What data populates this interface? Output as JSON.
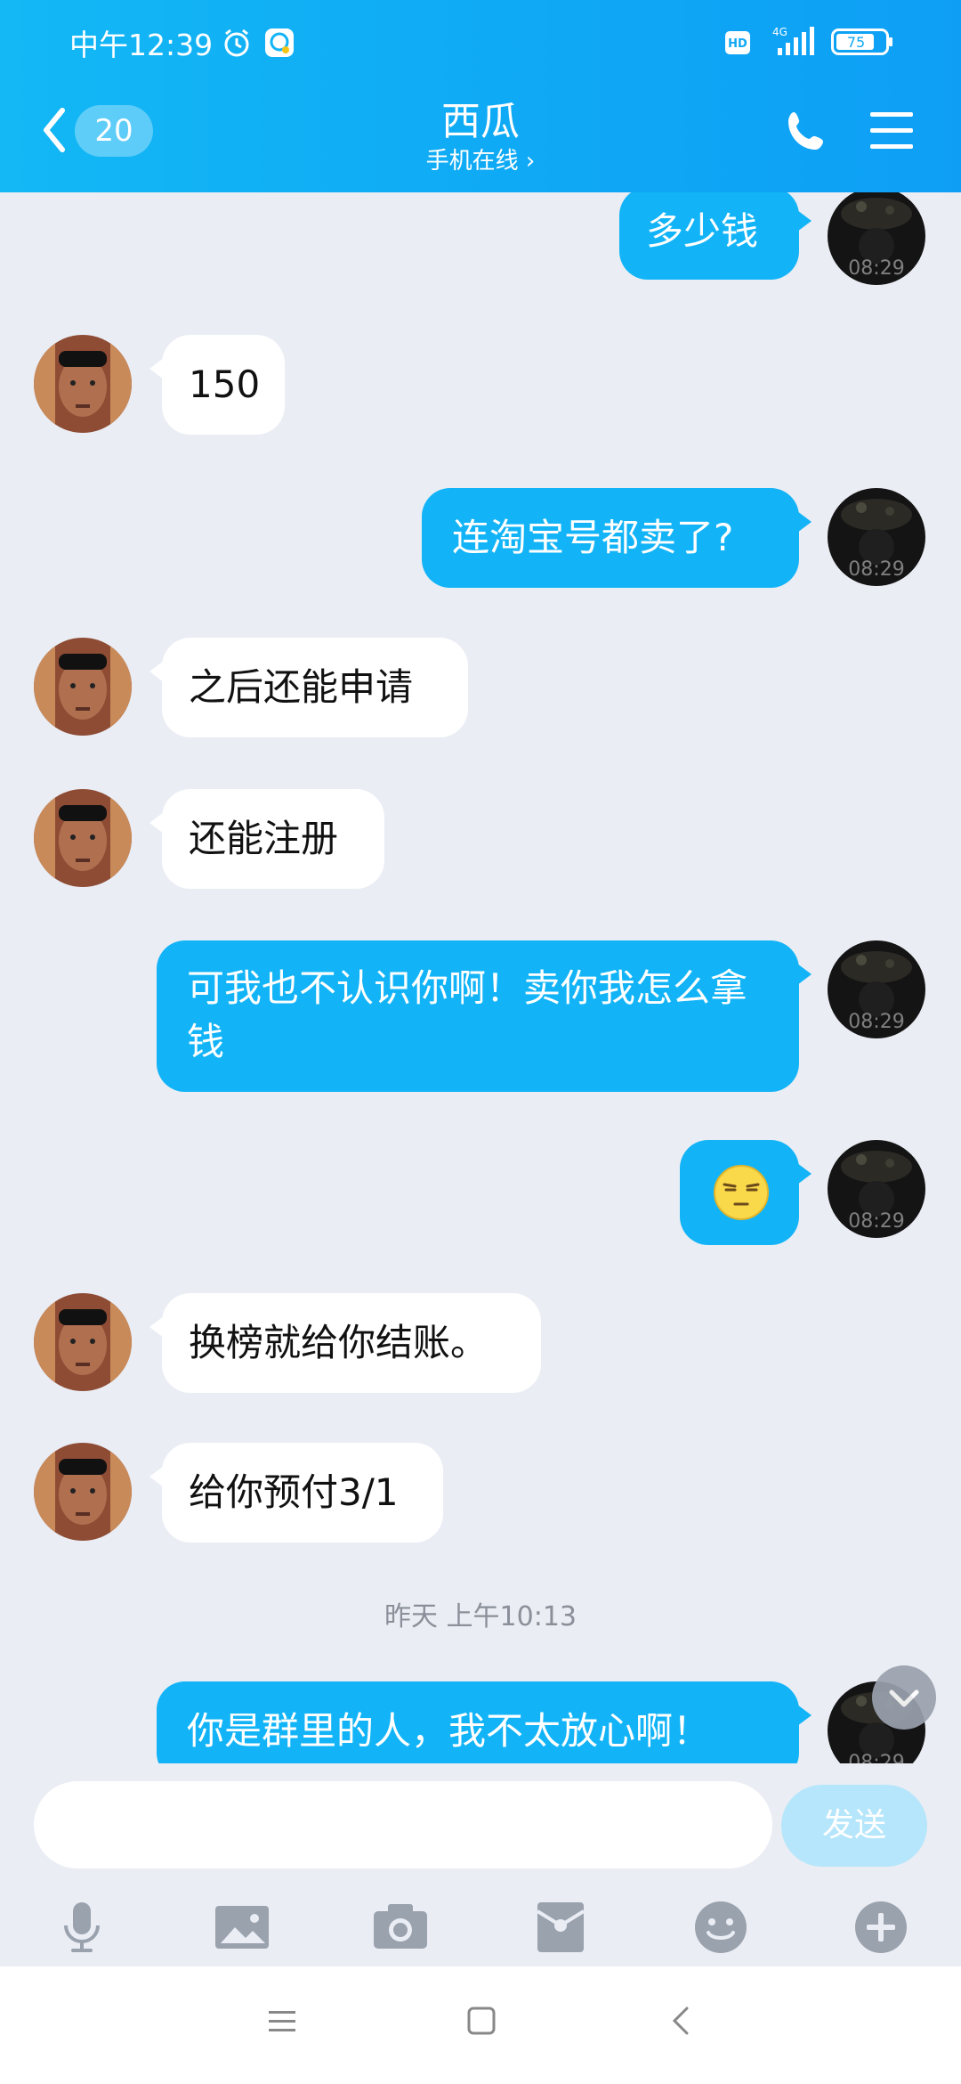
{
  "status_bar": {
    "time": "中午12:39",
    "battery": "75",
    "network": "4G",
    "hd": "HD"
  },
  "header": {
    "unread_count": "20",
    "title": "西瓜",
    "subtitle": "手机在线 ›"
  },
  "messages": [
    {
      "side": "out",
      "type": "text",
      "text": "多少钱"
    },
    {
      "side": "in",
      "type": "text",
      "text": "150"
    },
    {
      "side": "out",
      "type": "text",
      "text": "连淘宝号都卖了?"
    },
    {
      "side": "in",
      "type": "text",
      "text": "之后还能申请"
    },
    {
      "side": "in",
      "type": "text",
      "text": "还能注册"
    },
    {
      "side": "out",
      "type": "text",
      "text": "可我也不认识你啊！卖你我怎么拿钱"
    },
    {
      "side": "out",
      "type": "emoji",
      "text": "",
      "emoji": "smirk-emoji"
    },
    {
      "side": "in",
      "type": "text",
      "text": "换榜就给你结账。"
    },
    {
      "side": "in",
      "type": "text",
      "text": "给你预付3/1"
    },
    {
      "side": "out",
      "type": "text",
      "text": "你是群里的人，我不太放心啊！"
    }
  ],
  "avatar_overlay_text": "08:29",
  "timestamp_divider": "昨天 上午10:13",
  "composer": {
    "placeholder": "",
    "send_label": "发送"
  },
  "toolbar_icons": [
    "microphone-icon",
    "image-icon",
    "camera-icon",
    "red-packet-icon",
    "emoji-icon",
    "plus-icon"
  ],
  "colors": {
    "accent": "#12b4f7",
    "header": "#0fa9f5",
    "background": "#eaedf4"
  }
}
